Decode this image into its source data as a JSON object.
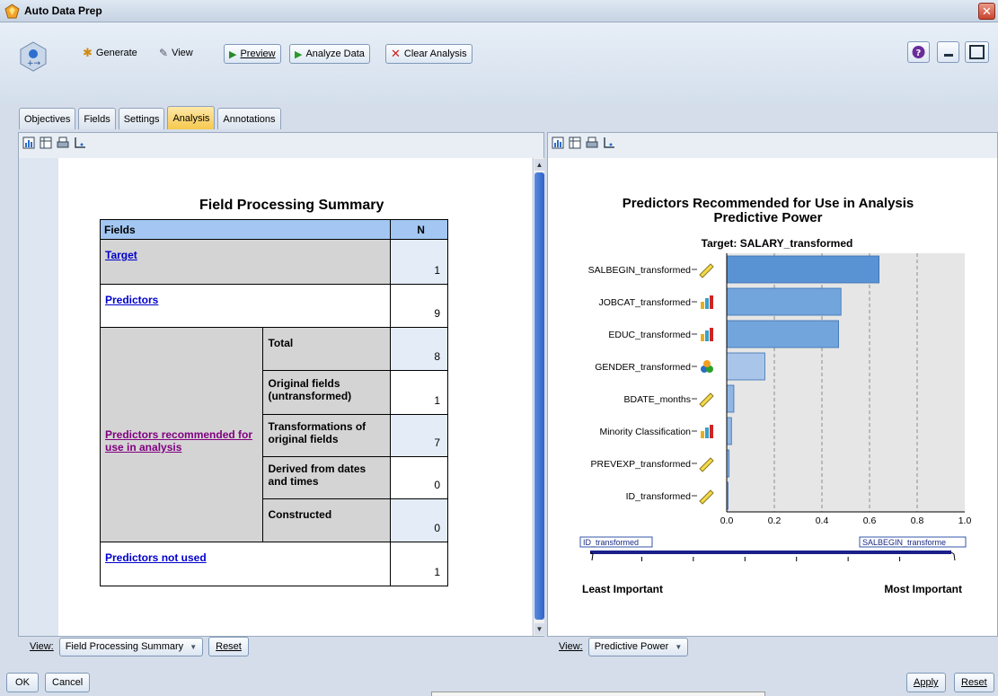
{
  "window": {
    "title": "Auto Data Prep"
  },
  "toolbar": {
    "generate_label": "Generate",
    "view_label": "View",
    "preview_label": "Preview",
    "analyze_label": "Analyze Data",
    "clear_label": "Clear Analysis"
  },
  "tabs": [
    {
      "label": "Objectives"
    },
    {
      "label": "Fields"
    },
    {
      "label": "Settings"
    },
    {
      "label": "Analysis",
      "active": true
    },
    {
      "label": "Annotations"
    }
  ],
  "summary": {
    "title": "Field Processing Summary",
    "header_fields": "Fields",
    "header_n": "N",
    "target_label": "Target",
    "target_n": "1",
    "predictors_label": "Predictors",
    "predictors_n": "9",
    "recommended_label": "Predictors recommended for use in analysis",
    "rows": [
      {
        "label": "Total",
        "n": "8"
      },
      {
        "label": "Original fields (untransformed)",
        "n": "1"
      },
      {
        "label": "Transformations of original fields",
        "n": "7"
      },
      {
        "label": "Derived from dates and times",
        "n": "0"
      },
      {
        "label": "Constructed",
        "n": "0"
      }
    ],
    "not_used_label": "Predictors not used",
    "not_used_n": "1"
  },
  "left_view": {
    "label": "View:",
    "value": "Field Processing Summary",
    "reset": "Reset"
  },
  "right_view": {
    "label": "View:",
    "value": "Predictive Power"
  },
  "chart_data": {
    "type": "bar",
    "title": "Predictors Recommended for Use in Analysis",
    "subtitle": "Predictive Power",
    "target_label": "Target: SALARY_transformed",
    "categories": [
      "SALBEGIN_transformed",
      "JOBCAT_transformed",
      "EDUC_transformed",
      "GENDER_transformed",
      "BDATE_months",
      "Minority Classification",
      "PREVEXP_transformed",
      "ID_transformed"
    ],
    "icons": [
      "ruler-icon",
      "bar-set-icon",
      "bar-set-icon",
      "nominal-icon",
      "ruler-icon",
      "bar-set-icon",
      "ruler-icon",
      "ruler-icon"
    ],
    "values": [
      0.64,
      0.48,
      0.47,
      0.16,
      0.03,
      0.02,
      0.01,
      0.003
    ],
    "xlim": [
      0,
      1
    ],
    "xticks": [
      "0.0",
      "0.2",
      "0.4",
      "0.6",
      "0.8",
      "1.0"
    ],
    "grid": "dashed-vertical",
    "bar_color": "#5b9bd5",
    "slider_left": "ID_transformed",
    "slider_right": "SALBEGIN_transforme",
    "least_label": "Least Important",
    "most_label": "Most Important"
  },
  "footer": {
    "ok": "OK",
    "cancel": "Cancel",
    "apply": "Apply",
    "reset": "Reset"
  }
}
